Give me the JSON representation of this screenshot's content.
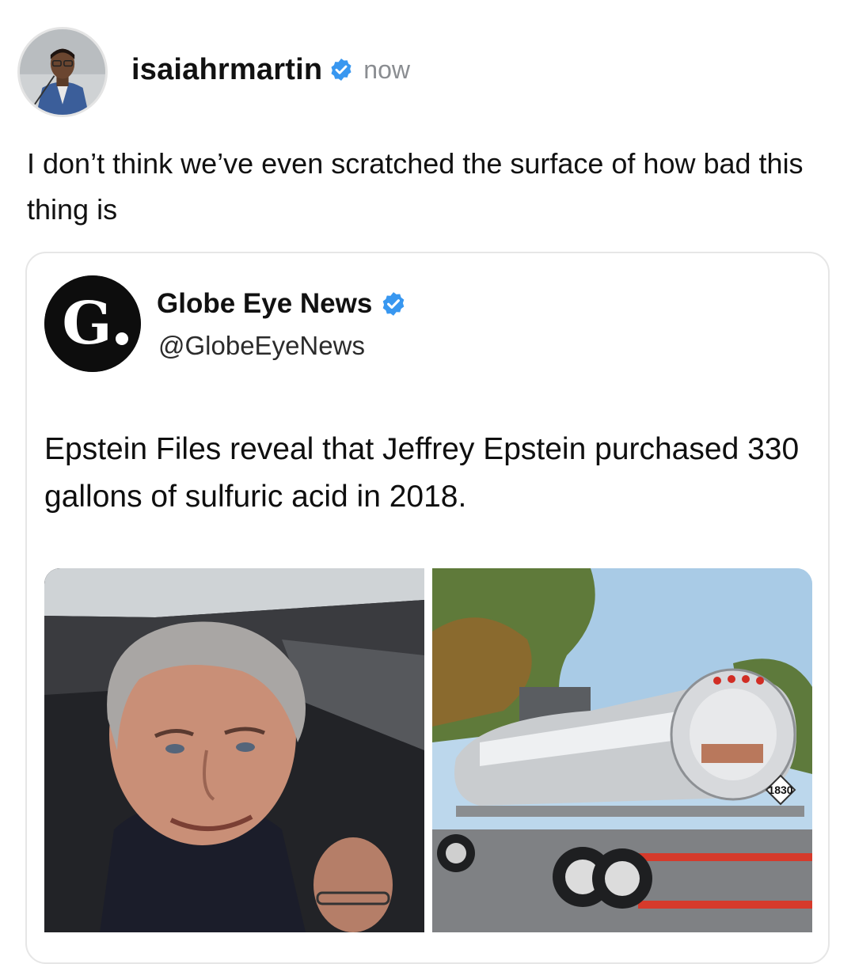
{
  "post": {
    "username": "isaiahrmartin",
    "time": "now",
    "text": "I don’t think we’ve even scratched the surface of how bad this thing is"
  },
  "embed": {
    "logo_letter": "G.",
    "name": "Globe Eye News",
    "handle": "@GlobeEyeNews",
    "text": "Epstein Files reveal that Jeffrey Epstein purchased 330 gallons of sulfuric acid in 2018.",
    "truck_placard": "1830"
  },
  "colors": {
    "verified": "#3897f0",
    "muted_text": "#8a8d91",
    "border": "#e6e6e6"
  },
  "icons": [
    "verified-badge-icon",
    "globe-eye-news-logo"
  ]
}
